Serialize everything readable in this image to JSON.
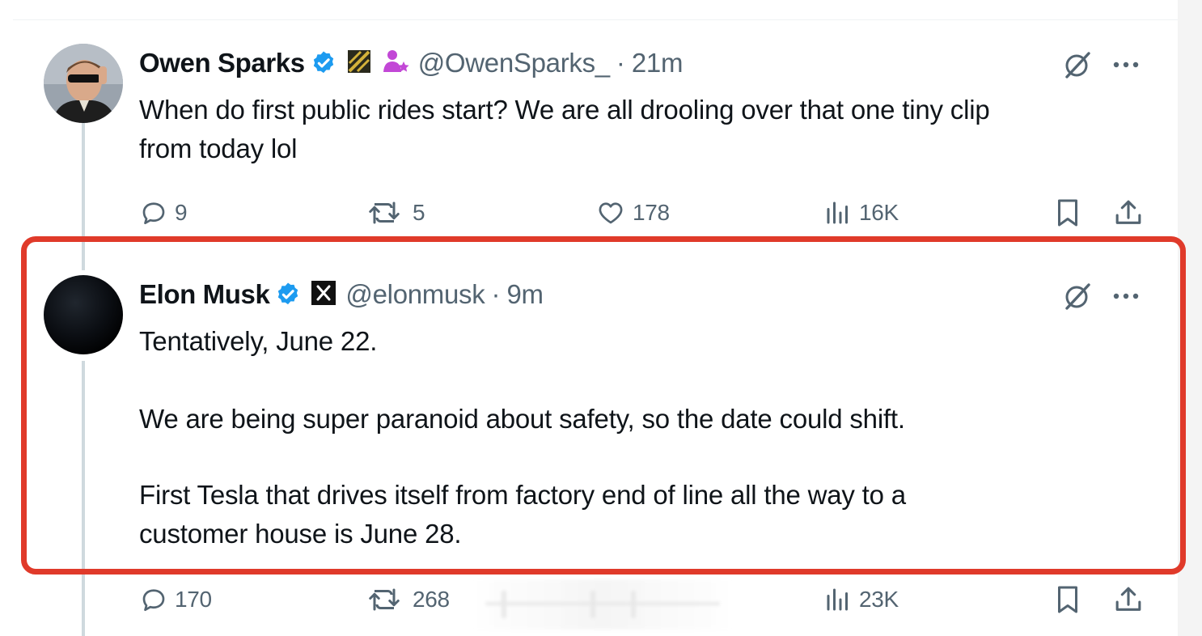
{
  "tweets": [
    {
      "display_name": "Owen Sparks",
      "handle": "@OwenSparks_",
      "separator": "·",
      "timestamp": "21m",
      "text_lines": [
        "When do first public rides start? We are all drooling over that one tiny clip",
        "from today lol"
      ],
      "metrics": {
        "replies": "9",
        "reposts": "5",
        "likes": "178",
        "views": "16K"
      }
    },
    {
      "display_name": "Elon Musk",
      "handle": "@elonmusk",
      "separator": "·",
      "timestamp": "9m",
      "paragraphs": [
        "Tentatively, June 22.",
        "We are being super paranoid about safety, so the date could shift.",
        "First Tesla that drives itself from factory end of line all the way to a",
        "customer house is June 28."
      ],
      "metrics": {
        "replies": "170",
        "reposts": "268",
        "views": "23K"
      }
    }
  ],
  "icons": {
    "reply": "speech-bubble-icon",
    "repost": "repost-arrows-icon",
    "like": "heart-icon",
    "views": "bar-chart-icon",
    "bookmark": "bookmark-icon",
    "share": "share-upload-icon",
    "grok": "grok-slash-circle-icon",
    "more": "ellipsis-icon",
    "verified": "blue-check-badge-icon"
  },
  "colors": {
    "text_primary": "#0f1419",
    "text_secondary": "#536471",
    "verified_blue": "#1d9bf0",
    "highlight_red": "#e03a2a",
    "thread_line": "#cfd9de"
  }
}
